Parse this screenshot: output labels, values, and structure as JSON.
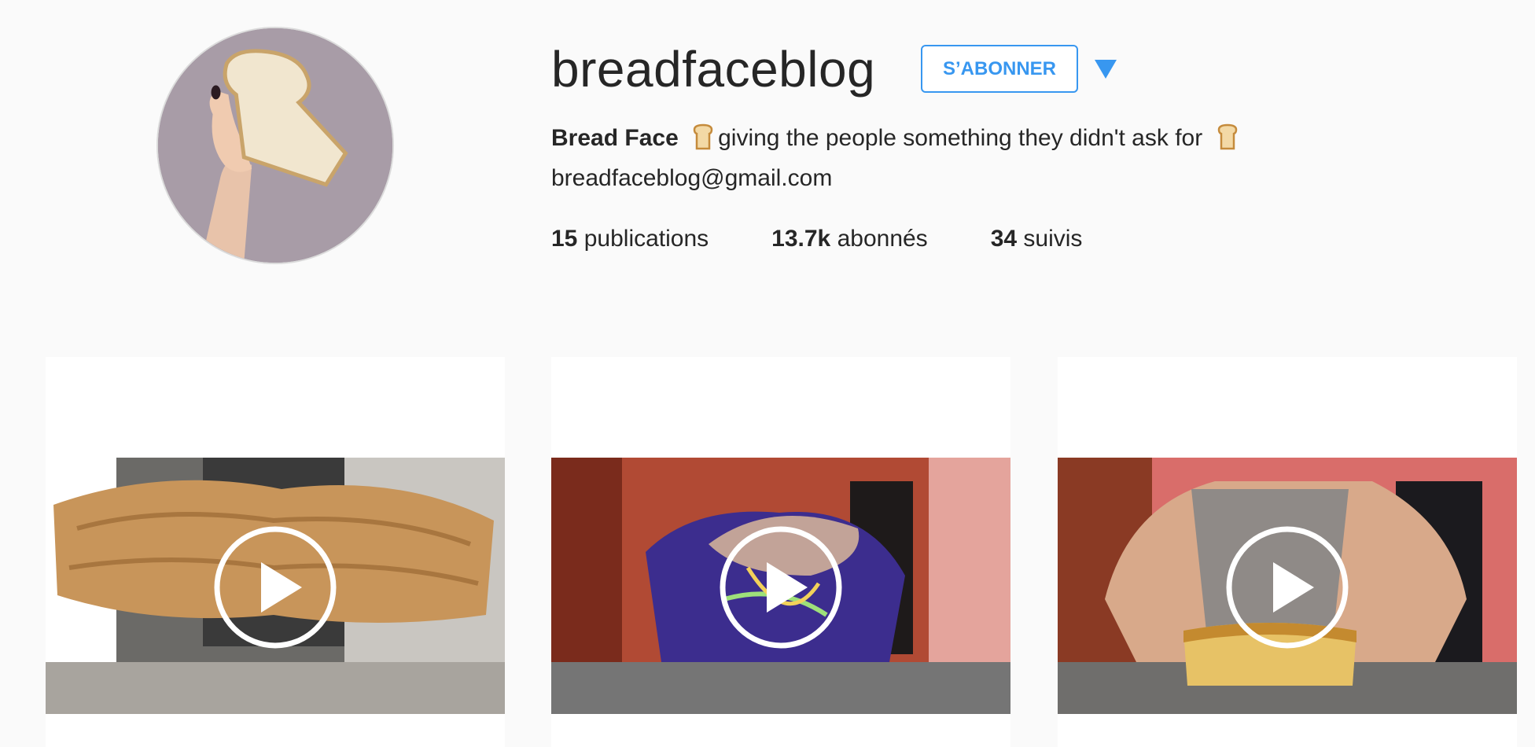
{
  "profile": {
    "username": "breadfaceblog",
    "follow_label": "S’ABONNER",
    "full_name": "Bread Face",
    "bio_text": "giving the people something they didn't ask for",
    "email": "breadfaceblog@gmail.com",
    "avatar_icon": "bread-slice-photo",
    "dropdown_icon": "triangle-down-icon"
  },
  "stats": {
    "posts_count": "15",
    "posts_label": "publications",
    "followers_count": "13.7k",
    "followers_label": "abonnés",
    "following_count": "34",
    "following_label": "suivis"
  },
  "posts": [
    {
      "type": "video",
      "icon": "play-icon"
    },
    {
      "type": "video",
      "icon": "play-icon"
    },
    {
      "type": "video",
      "icon": "play-icon"
    }
  ],
  "colors": {
    "accent": "#3897f0",
    "background": "#fafafa",
    "text": "#262626"
  }
}
